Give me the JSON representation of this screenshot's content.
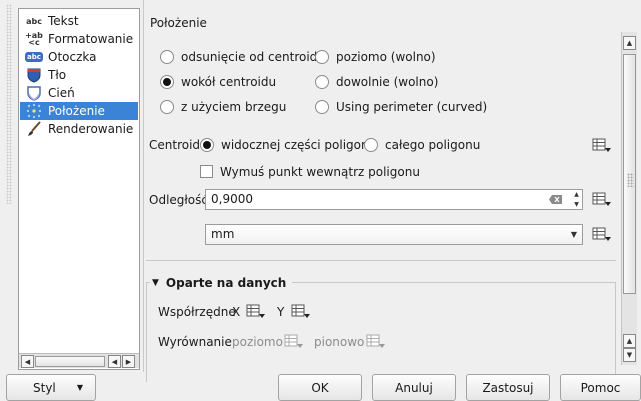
{
  "sidebar": {
    "items": [
      {
        "label": "Tekst",
        "icon": "abc-text-icon"
      },
      {
        "label": "Formatowanie",
        "icon": "text-format-icon"
      },
      {
        "label": "Otoczka",
        "icon": "buffer-abc-icon"
      },
      {
        "label": "Tło",
        "icon": "background-shield-icon"
      },
      {
        "label": "Cień",
        "icon": "shadow-icon"
      },
      {
        "label": "Położenie",
        "icon": "placement-icon",
        "selected": true
      },
      {
        "label": "Renderowanie",
        "icon": "render-brush-icon"
      }
    ]
  },
  "placement": {
    "title": "Położenie",
    "options": [
      {
        "label": "odsunięcie od centroidu",
        "checked": false
      },
      {
        "label": "poziomo (wolno)",
        "checked": false
      },
      {
        "label": "wokół centroidu",
        "checked": true
      },
      {
        "label": "dowolnie (wolno)",
        "checked": false
      },
      {
        "label": "z użyciem brzegu",
        "checked": false
      },
      {
        "label": "Using perimeter (curved)",
        "checked": false
      }
    ],
    "centroid": {
      "label": "Centroid",
      "opt_visible": "widocznej części poligonu",
      "opt_whole": "całego poligonu",
      "selected": "widocznej części poligonu"
    },
    "force_inside": {
      "label": "Wymuś punkt wewnątrz poligonu",
      "checked": false
    },
    "distance": {
      "label": "Odległość",
      "value": "0,9000"
    },
    "unit": {
      "value": "mm"
    },
    "data_defined": {
      "title": "Oparte na danych",
      "coords_label": "Współrzędne",
      "x_label": "X",
      "y_label": "Y",
      "alignment_label": "Wyrównanie",
      "horizontal_label": "poziomo",
      "vertical_label": "pionowo"
    }
  },
  "buttons": {
    "style": "Styl",
    "ok": "OK",
    "cancel": "Anuluj",
    "apply": "Zastosuj",
    "help": "Pomoc"
  },
  "colors": {
    "selection": "#3a83d6",
    "panel_bg": "#efefef"
  }
}
